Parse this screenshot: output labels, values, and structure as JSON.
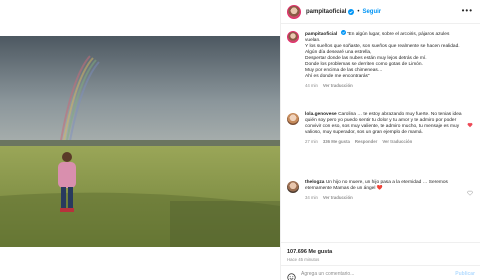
{
  "post": {
    "username": "pampitaoficial",
    "follow_label": "Seguir",
    "more_label": "•••",
    "caption": {
      "username": "pampitaoficial",
      "text": "“En algún lugar, sobre el arcoiris, pájaros azules vuelan.\nY los sueños que soñaste, son sueños que realmente se hacen realidad.\nAlgún día desearé una estrella,\nDespertar donde las nubes están muy lejos detrás de mí.\nDonde los problemas se derriten como gotas de Limón.\nMuy por encima de las chimeneas…\nAhí es donde me encontrarás”",
      "time": "44 min",
      "translation_label": "Ver traducción"
    },
    "likes": "107.696 Me gusta",
    "time_ago": "Hace 45 minutos",
    "add_comment_placeholder": "Agrega un comentario...",
    "publish_label": "Publicar"
  },
  "comments": [
    {
      "username": "lola.genovese",
      "text": "Carolina … te estoy abrazando muy fuerte. No tenias idea quién soy pero yo puedo sentir tu dolor y tu amor y te admiro por poder convivir con eso, sos muy valiente, te admiro mucho, tu mensaje es muy valioso, muy superador, sos un gran ejemplo de mamá.",
      "time": "27 min",
      "likes": "336 Me gusta",
      "reply_label": "Responder",
      "translation_label": "Ver traducción"
    },
    {
      "username": "thelogza",
      "text": "Un hijo no muere, un hijo pasa a la eternidad … Seremos eternamente Mamas de un ángel ❤️",
      "time": "34 min",
      "likes": "",
      "reply_label": "",
      "translation_label": "Ver traducción"
    }
  ],
  "colors": {
    "accent_blue": "#0095f6",
    "heart_red": "#ed4956",
    "meta_gray": "#8e8e8e"
  },
  "icons": {
    "verified": "verified-badge-icon",
    "heart": "heart-icon",
    "emoji": "emoji-icon",
    "more": "more-options-icon"
  }
}
